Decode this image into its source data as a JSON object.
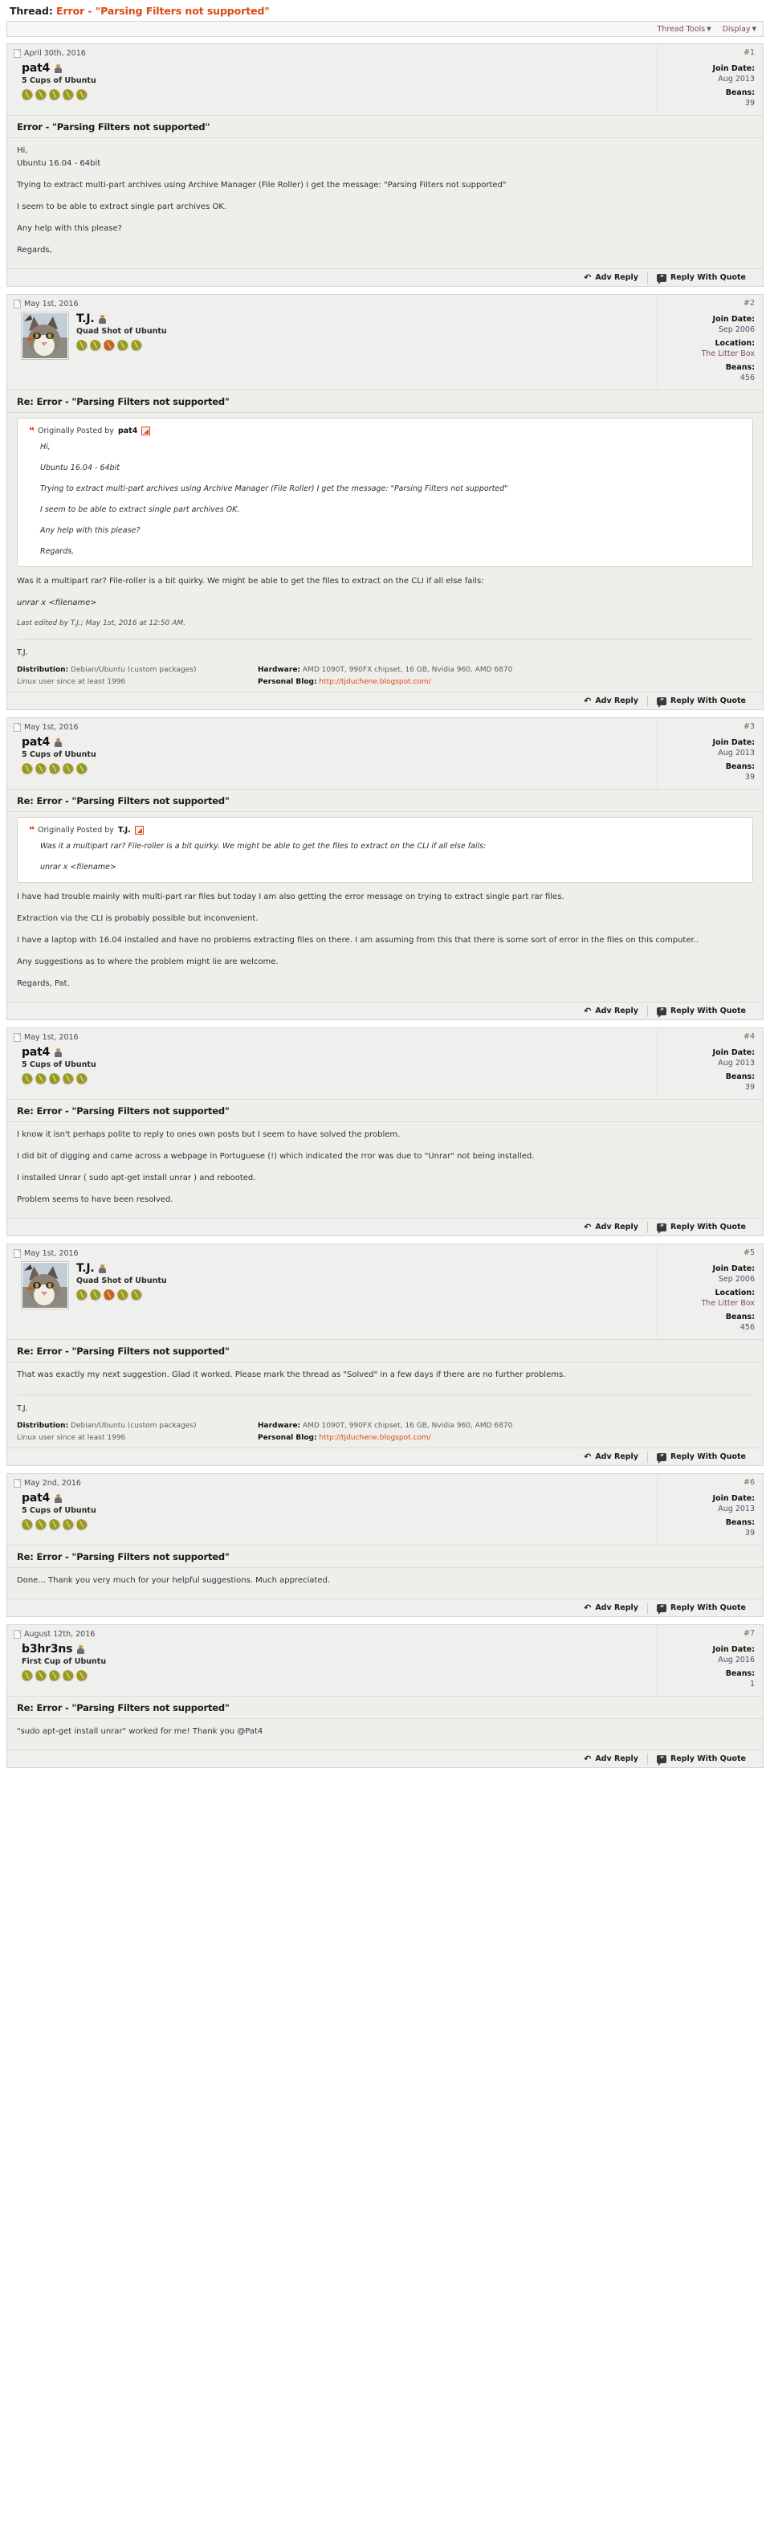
{
  "thread": {
    "label": "Thread:",
    "title": "Error - \"Parsing Filters not supported\""
  },
  "toolbar": {
    "thread_tools": "Thread Tools",
    "display": "Display"
  },
  "footer_buttons": {
    "adv_reply": "Adv Reply",
    "reply_with_quote": "Reply With Quote"
  },
  "labels": {
    "join_date": "Join Date:",
    "location": "Location:",
    "beans": "Beans:",
    "originally_posted_by": "Originally Posted by",
    "distribution": "Distribution:",
    "hardware": "Hardware:",
    "personal_blog": "Personal Blog:"
  },
  "signature_tj": {
    "name": "T.J.",
    "distribution_value": "Debian/Ubuntu (custom packages)",
    "hardware_value": "AMD 1090T, 990FX chipset, 16 GB, Nvidia 960, AMD 6870",
    "linux_since": "Linux user since at least 1996",
    "blog_url": "http://tjduchene.blogspot.com/"
  },
  "posts": [
    {
      "number": "#1",
      "date": "April 30th, 2016",
      "username": "pat4",
      "usertitle": "5 Cups of Ubuntu",
      "beans_count": 5,
      "orange_bean_index": -1,
      "has_avatar": false,
      "join_date": "Aug 2013",
      "location": null,
      "beans": "39",
      "subject": "Error - \"Parsing Filters not supported\"",
      "paragraphs": [
        "Hi,",
        "Ubuntu 16.04 - 64bit",
        "Trying to extract multi-part archives using Archive Manager (File Roller) I get the message: \"Parsing Filters not supported\"",
        "I seem to be able to extract single part archives OK.",
        "Any help with this please?",
        "Regards,"
      ],
      "quote": null,
      "last_edited": null,
      "signature": false
    },
    {
      "number": "#2",
      "date": "May 1st, 2016",
      "username": "T.J.",
      "usertitle": "Quad Shot of Ubuntu",
      "beans_count": 5,
      "orange_bean_index": 2,
      "has_avatar": true,
      "join_date": "Sep 2006",
      "location": "The Litter Box",
      "beans": "456",
      "subject": "Re: Error - \"Parsing Filters not supported\"",
      "quote": {
        "author": "pat4",
        "paragraphs": [
          "Hi,",
          "Ubuntu 16.04 - 64bit",
          "Trying to extract multi-part archives using Archive Manager (File Roller) I get the message: \"Parsing Filters not supported\"",
          "I seem to be able to extract single part archives OK.",
          "Any help with this please?",
          "Regards,"
        ]
      },
      "paragraphs": [
        "Was it a multipart rar? File-roller is a bit quirky. We might be able to get the files to extract on the CLI if all else fails:",
        "unrar x <filename>"
      ],
      "last_edited": "Last edited by T.J.; May 1st, 2016 at 12:50 AM.",
      "signature": true
    },
    {
      "number": "#3",
      "date": "May 1st, 2016",
      "username": "pat4",
      "usertitle": "5 Cups of Ubuntu",
      "beans_count": 5,
      "orange_bean_index": -1,
      "has_avatar": false,
      "join_date": "Aug 2013",
      "location": null,
      "beans": "39",
      "subject": "Re: Error - \"Parsing Filters not supported\"",
      "quote": {
        "author": "T.J.",
        "paragraphs": [
          "Was it a multipart rar? File-roller is a bit quirky. We might be able to get the files to extract on the CLI if all else fails:",
          "unrar x <filename>"
        ]
      },
      "paragraphs": [
        "I have had trouble mainly with multi-part rar files but today I am also getting the error message on trying to extract single part rar files.",
        "Extraction via the CLI is probably possible but inconvenient.",
        "I have a laptop with 16.04 installed and have no problems extracting files on there. I am assuming from this that there is some sort of error in the files on this computer..",
        "Any suggestions as to where the problem might lie are welcome.",
        "Regards, Pat."
      ],
      "last_edited": null,
      "signature": false
    },
    {
      "number": "#4",
      "date": "May 1st, 2016",
      "username": "pat4",
      "usertitle": "5 Cups of Ubuntu",
      "beans_count": 5,
      "orange_bean_index": -1,
      "has_avatar": false,
      "join_date": "Aug 2013",
      "location": null,
      "beans": "39",
      "subject": "Re: Error - \"Parsing Filters not supported\"",
      "quote": null,
      "paragraphs": [
        "I know it isn't perhaps polite to reply to ones own posts but I seem to have solved the problem.",
        "I did bit of digging and came across a webpage in Portuguese (!) which indicated the rror was due to \"Unrar\" not being installed.",
        "I installed Unrar ( sudo apt-get install unrar ) and rebooted.",
        "Problem seems to have been resolved."
      ],
      "last_edited": null,
      "signature": false
    },
    {
      "number": "#5",
      "date": "May 1st, 2016",
      "username": "T.J.",
      "usertitle": "Quad Shot of Ubuntu",
      "beans_count": 5,
      "orange_bean_index": 2,
      "has_avatar": true,
      "join_date": "Sep 2006",
      "location": "The Litter Box",
      "beans": "456",
      "subject": "Re: Error - \"Parsing Filters not supported\"",
      "quote": null,
      "paragraphs": [
        "That was exactly my next suggestion. Glad it worked. Please mark the thread as \"Solved\" in a few days if there are no further problems."
      ],
      "last_edited": null,
      "signature": true
    },
    {
      "number": "#6",
      "date": "May 2nd, 2016",
      "username": "pat4",
      "usertitle": "5 Cups of Ubuntu",
      "beans_count": 5,
      "orange_bean_index": -1,
      "has_avatar": false,
      "join_date": "Aug 2013",
      "location": null,
      "beans": "39",
      "subject": "Re: Error - \"Parsing Filters not supported\"",
      "quote": null,
      "paragraphs": [
        "Done... Thank you very much for your helpful suggestions. Much appreciated."
      ],
      "last_edited": null,
      "signature": false
    },
    {
      "number": "#7",
      "date": "August 12th, 2016",
      "username": "b3hr3ns",
      "usertitle": "First Cup of Ubuntu",
      "beans_count": 5,
      "orange_bean_index": -1,
      "has_avatar": false,
      "join_date": "Aug 2016",
      "location": null,
      "beans": "1",
      "subject": "Re: Error - \"Parsing Filters not supported\"",
      "quote": null,
      "paragraphs": [
        "\"sudo apt-get install unrar\" worked for me! Thank you @Pat4"
      ],
      "last_edited": null,
      "signature": false
    }
  ]
}
